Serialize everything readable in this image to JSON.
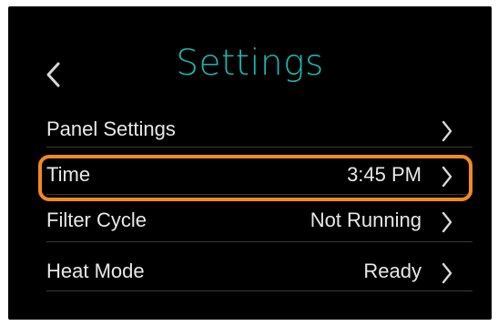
{
  "header": {
    "title": "Settings",
    "back_icon": "chevron-left-icon",
    "title_color": "#18b9b0"
  },
  "settings": {
    "items": [
      {
        "label": "Panel Settings",
        "value": "",
        "icon": "chevron-right-icon"
      },
      {
        "label": "Time",
        "value": "3:45 PM",
        "icon": "chevron-right-icon",
        "highlighted": true
      },
      {
        "label": "Filter Cycle",
        "value": "Not Running",
        "icon": "chevron-right-icon"
      },
      {
        "label": "Heat Mode",
        "value": "Ready",
        "icon": "chevron-right-icon"
      }
    ]
  },
  "highlight_color": "#f28a1c"
}
